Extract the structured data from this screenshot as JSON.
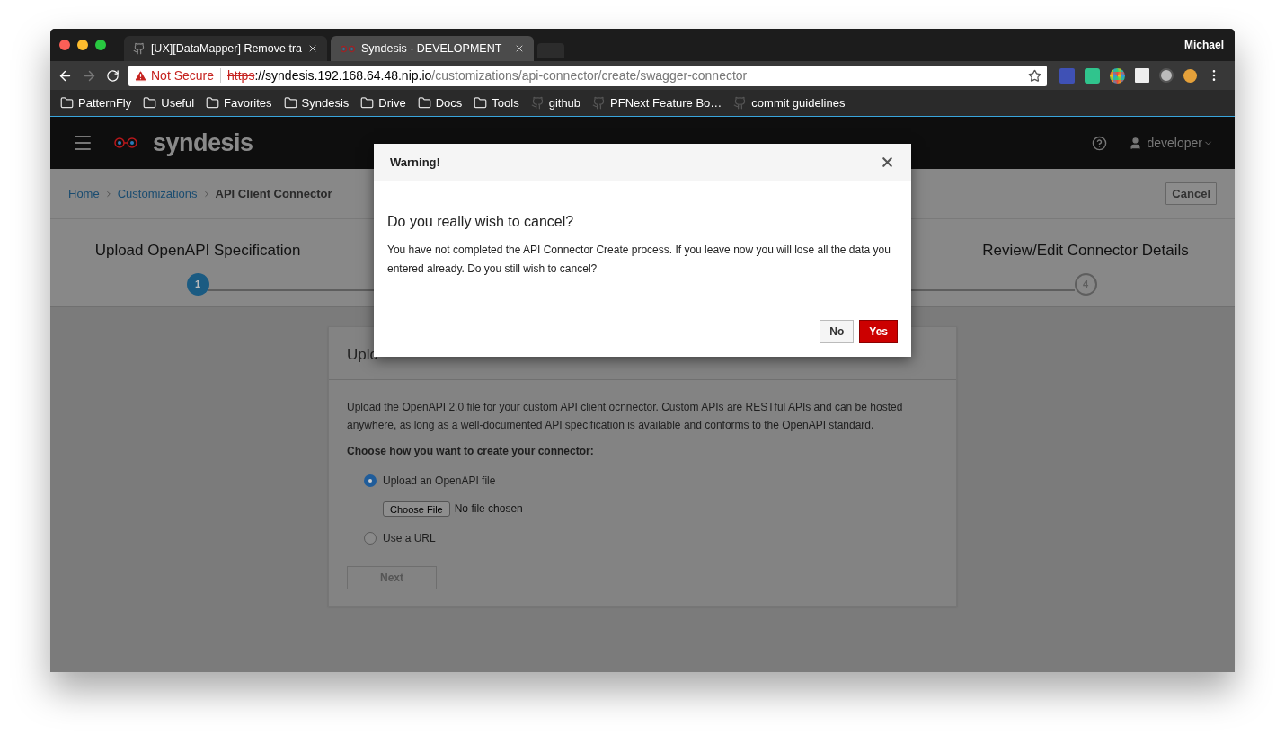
{
  "browser": {
    "tabs": [
      {
        "title": "[UX][DataMapper] Remove tra",
        "selected": false,
        "kind": "github"
      },
      {
        "title": "Syndesis - DEVELOPMENT",
        "selected": true,
        "kind": "syndesis"
      }
    ],
    "profile": "Michael",
    "address": {
      "security": "Not Secure",
      "scheme": "https",
      "rest": "://syndesis.192.168.64.48.nip.io",
      "path": "/customizations/api-connector/create/swagger-connector"
    },
    "bookmarks": [
      {
        "label": "PatternFly",
        "kind": "folder"
      },
      {
        "label": "Useful",
        "kind": "folder"
      },
      {
        "label": "Favorites",
        "kind": "folder"
      },
      {
        "label": "Syndesis",
        "kind": "folder"
      },
      {
        "label": "Drive",
        "kind": "folder"
      },
      {
        "label": "Docs",
        "kind": "folder"
      },
      {
        "label": "Tools",
        "kind": "folder"
      },
      {
        "label": "github",
        "kind": "github"
      },
      {
        "label": "PFNext Feature Bo…",
        "kind": "github"
      },
      {
        "label": "commit guidelines",
        "kind": "github"
      }
    ]
  },
  "app": {
    "brand": "syndesis",
    "user": "developer",
    "breadcrumb": [
      {
        "label": "Home",
        "kind": "link"
      },
      {
        "label": "Customizations",
        "kind": "link"
      },
      {
        "label": "API Client Connector",
        "kind": "current"
      }
    ],
    "cancel": "Cancel",
    "steps": [
      {
        "number": "1",
        "label": "Upload OpenAPI Specification",
        "selected": true
      },
      {
        "number": "4",
        "label": "Review/Edit Connector Details",
        "selected": false
      }
    ],
    "panel": {
      "title": "Uplo",
      "description": "Upload the OpenAPI 2.0 file for your custom API client ocnnector. Custom APIs are RESTful APIs and can be hosted anywhere, as long as a well-documented API specification is available and conforms to the OpenAPI standard.",
      "prompt": "Choose how you want to create your connector:",
      "options": [
        {
          "label": "Upload an OpenAPI file",
          "selected": true
        },
        {
          "label": "Use a URL",
          "selected": false
        }
      ],
      "file_button": "Choose File",
      "file_status": "No file chosen",
      "next": {
        "label": "Next",
        "disabled": true
      }
    }
  },
  "modal": {
    "title": "Warning!",
    "heading": "Do you really wish to cancel?",
    "message": "You have not completed the API Connector Create process. If you leave now you will lose all the data you entered already. Do you still wish to cancel?",
    "buttons": [
      {
        "label": "No",
        "kind": "default"
      },
      {
        "label": "Yes",
        "kind": "primary"
      }
    ]
  }
}
